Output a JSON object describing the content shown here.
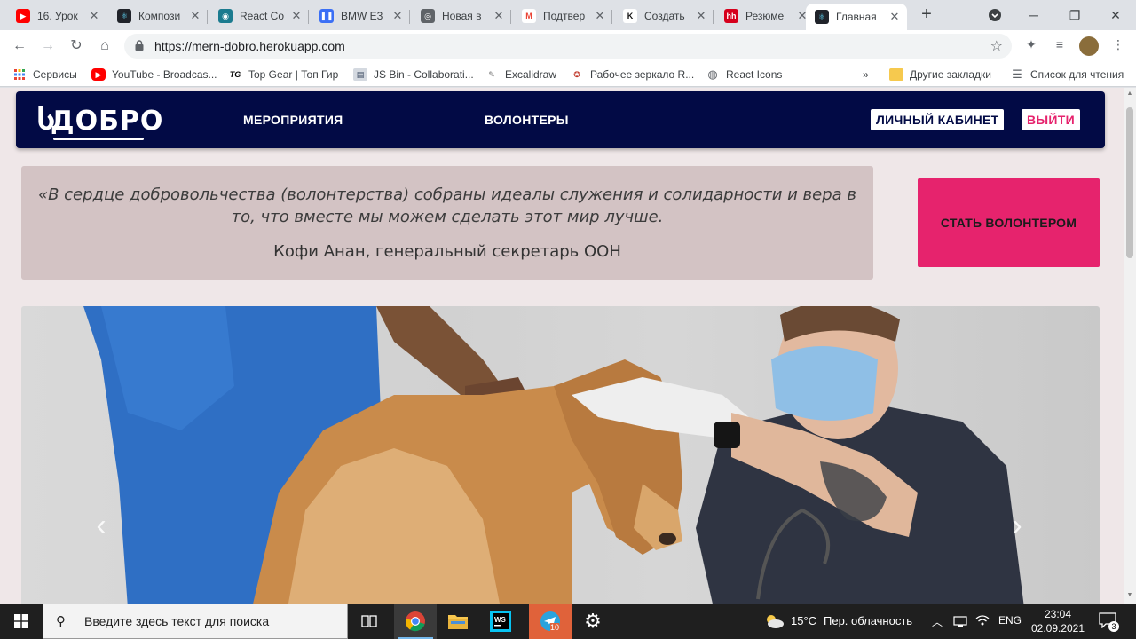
{
  "browser": {
    "tabs": [
      {
        "title": "16. Урок",
        "fav_color": "#ff0000",
        "fav_glyph": "▶"
      },
      {
        "title": "Компози",
        "fav_color": "#20232a",
        "fav_glyph": "⚛"
      },
      {
        "title": "React Co",
        "fav_color": "#1b7b8f",
        "fav_glyph": "◉"
      },
      {
        "title": "BMW E3",
        "fav_color": "#3b6ff5",
        "fav_glyph": "❚❚"
      },
      {
        "title": "Новая в",
        "fav_color": "#5f6368",
        "fav_glyph": "◎"
      },
      {
        "title": "Подтвер",
        "fav_color": "#ffffff",
        "fav_glyph": "M"
      },
      {
        "title": "Создать",
        "fav_color": "#ffffff",
        "fav_glyph": "K"
      },
      {
        "title": "Резюме",
        "fav_color": "#d6001c",
        "fav_glyph": "hh"
      },
      {
        "title": "Главная",
        "fav_color": "#20232a",
        "fav_glyph": "⚛"
      }
    ],
    "url": "https://mern-dobro.herokuapp.com",
    "bookmarks": [
      {
        "label": "Сервисы",
        "icon": "apps-grid-icon"
      },
      {
        "label": "YouTube - Broadcas...",
        "icon": "youtube-icon"
      },
      {
        "label": "Top Gear | Топ Гир",
        "icon": "tg-icon"
      },
      {
        "label": "JS Bin - Collaborati...",
        "icon": "jsbin-icon"
      },
      {
        "label": "Excalidraw",
        "icon": "excalidraw-icon"
      },
      {
        "label": "Рабочее зеркало R...",
        "icon": "mirror-icon"
      },
      {
        "label": "React Icons",
        "icon": "globe-icon"
      }
    ],
    "bookmarks_overflow": "»",
    "other_bookmarks": "Другие закладки",
    "reading_list": "Список для чтения"
  },
  "site": {
    "logo": "ДОБРО",
    "nav": {
      "events": "МЕРОПРИЯТИЯ",
      "volunteers": "ВОЛОНТЕРЫ",
      "cabinet": "ЛИЧНЫЙ КАБИНЕТ",
      "logout": "ВЫЙТИ"
    },
    "quote": {
      "text": "«В сердце добровольчества (волонтерства) собраны идеалы служения и солидарности и вера в то, что вместе мы можем сделать этот мир лучше.",
      "author": "Кофи Анан, генеральный секретарь ООН"
    },
    "cta": "СТАТЬ ВОЛОНТЕРОМ",
    "colors": {
      "nav_bg": "#020a45",
      "accent": "#e6236d",
      "page_bg": "#efe7e8",
      "quote_bg": "#d3c3c4"
    }
  },
  "taskbar": {
    "search_placeholder": "Введите здесь текст для поиска",
    "weather_temp": "15°C",
    "weather_desc": "Пер. облачность",
    "language": "ENG",
    "time": "23:04",
    "date": "02.09.2021",
    "telegram_badge": "10",
    "notifications": "3"
  }
}
